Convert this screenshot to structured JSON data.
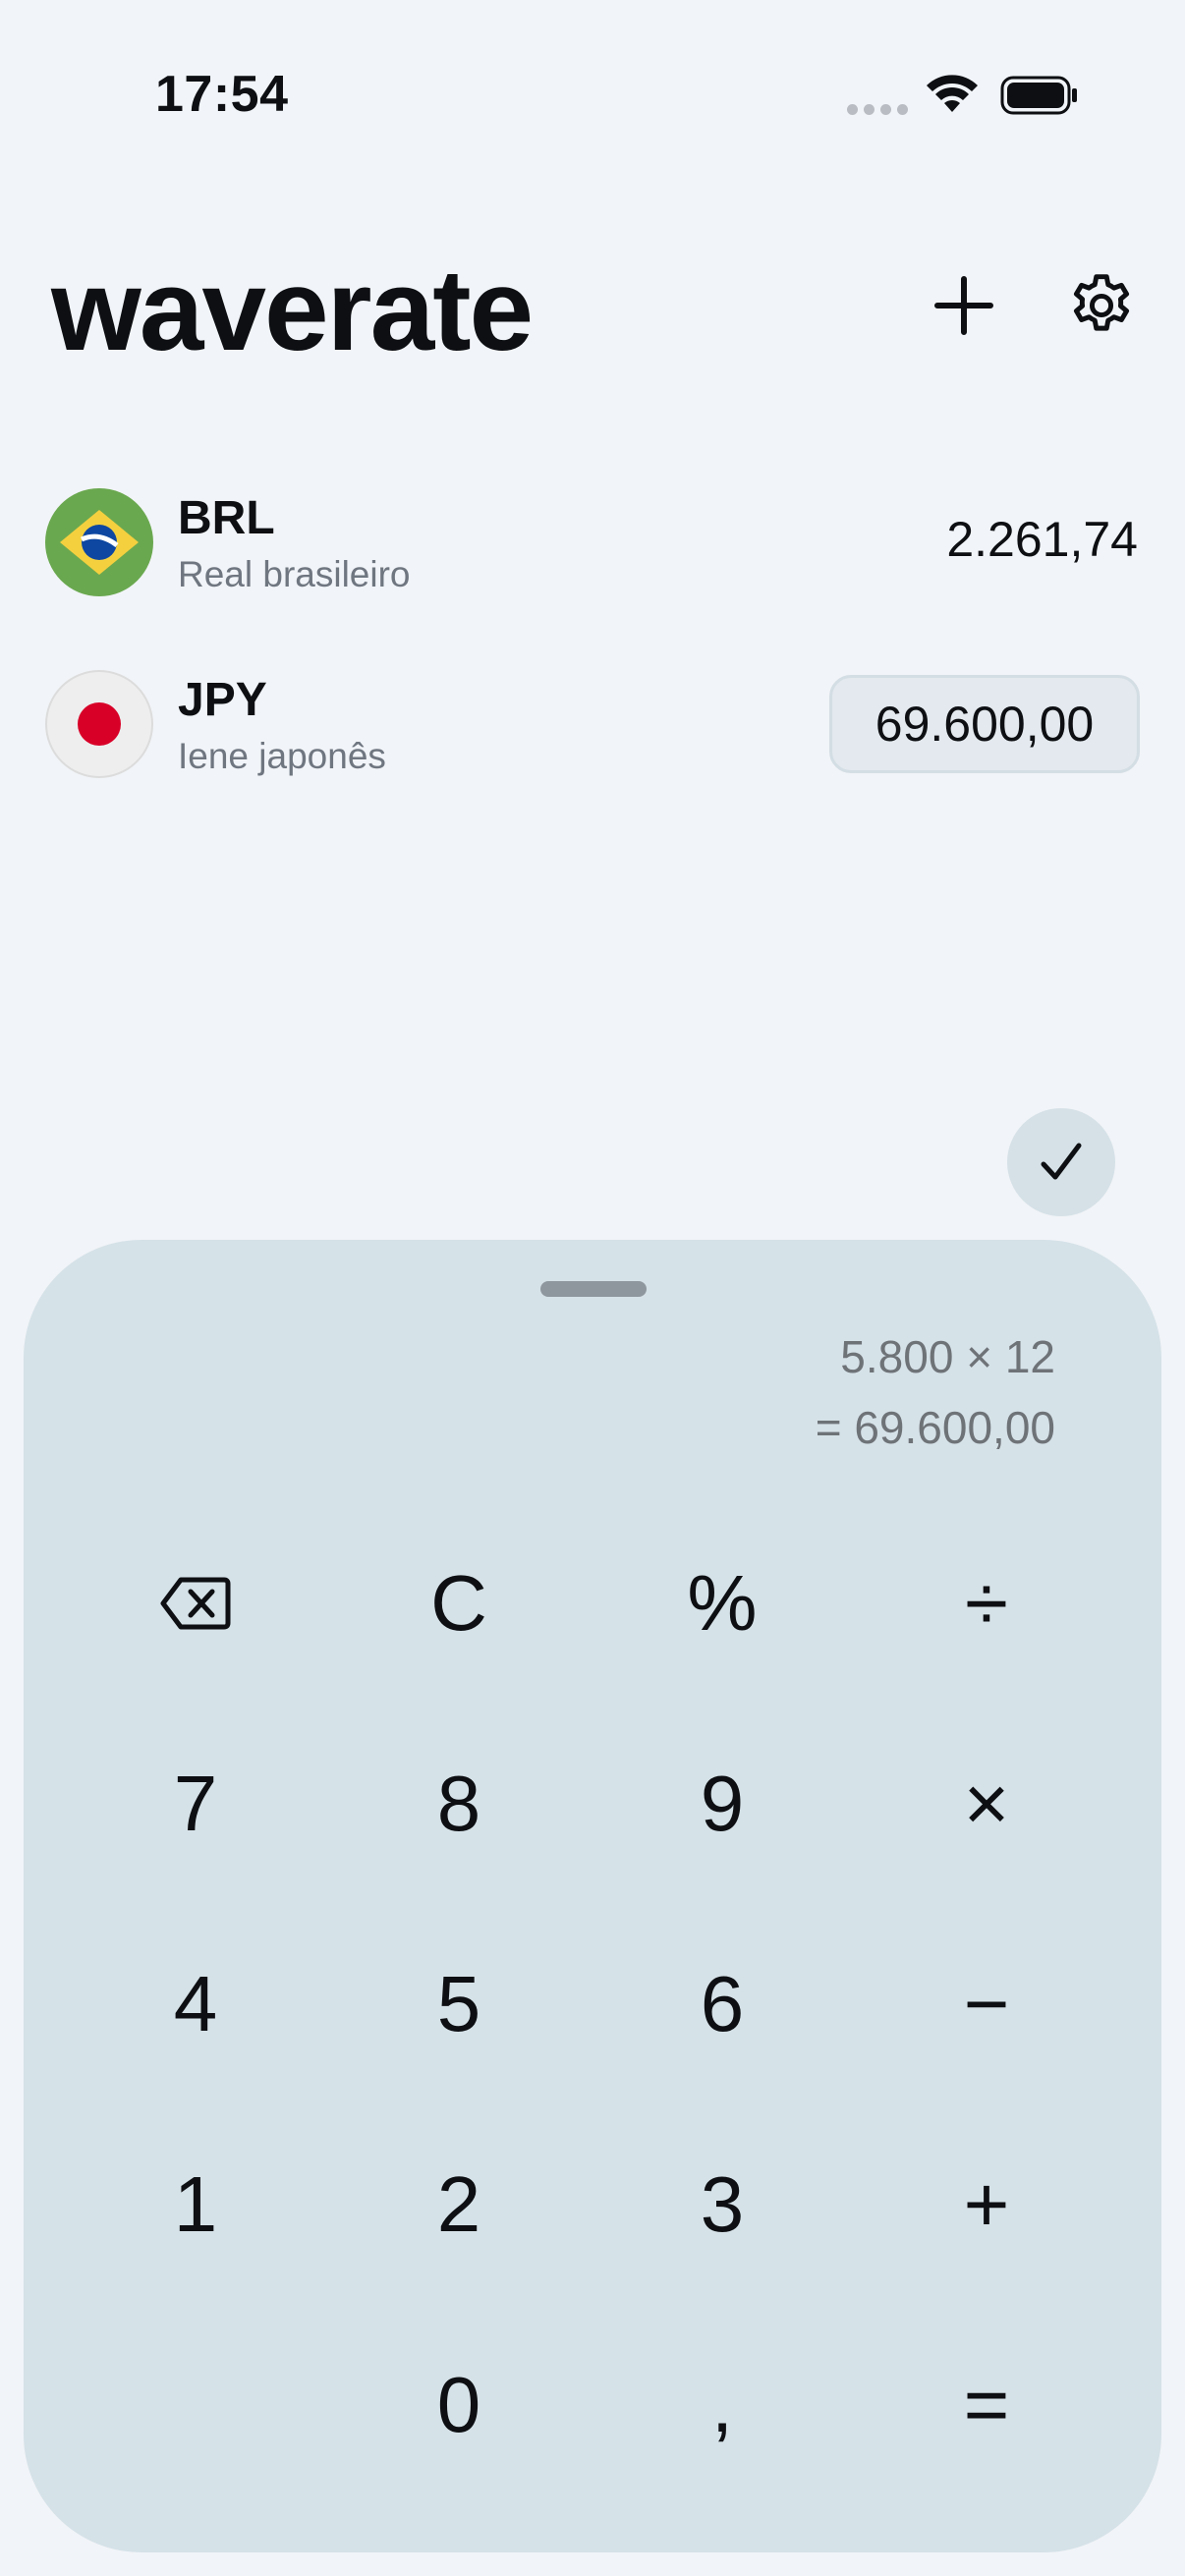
{
  "status_bar": {
    "time": "17:54"
  },
  "app": {
    "title": "waverate"
  },
  "currencies": [
    {
      "code": "BRL",
      "name": "Real brasileiro",
      "amount": "2.261,74",
      "flag": "brazil-flag"
    },
    {
      "code": "JPY",
      "name": "Iene japonês",
      "amount": "69.600,00",
      "flag": "japan-flag"
    }
  ],
  "calculator": {
    "expression": "5.800 × 12",
    "result": "= 69.600,00",
    "keys": {
      "clear": "C",
      "percent": "%",
      "divide": "÷",
      "seven": "7",
      "eight": "8",
      "nine": "9",
      "multiply": "×",
      "four": "4",
      "five": "5",
      "six": "6",
      "minus": "−",
      "one": "1",
      "two": "2",
      "three": "3",
      "plus": "+",
      "zero": "0",
      "comma": ",",
      "equals": "="
    }
  },
  "colors": {
    "background": "#f1f4f8",
    "keypad": "#d5e2e8",
    "brazil_green": "#6aa84f",
    "brazil_yellow": "#f4d03f",
    "brazil_blue": "#0d47a1",
    "japan_red": "#d80027"
  }
}
